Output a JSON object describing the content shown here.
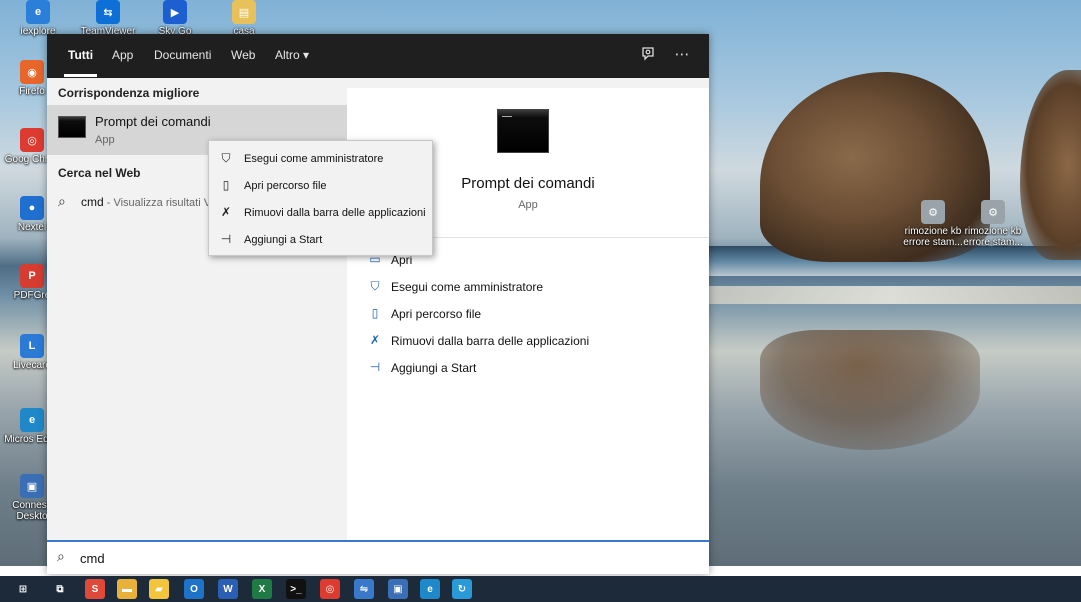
{
  "desktop": {
    "icons": [
      {
        "label": "iexplore",
        "color": "#2b7fd8",
        "glyph": "e",
        "icon": "internet-explorer-icon"
      },
      {
        "label": "TeamViewer",
        "color": "#0e6fd6",
        "glyph": "⇆",
        "icon": "teamviewer-icon"
      },
      {
        "label": "Sky Go",
        "color": "#1b5fd1",
        "glyph": "▶",
        "icon": "sky-go-icon"
      },
      {
        "label": "casa",
        "color": "#e9c15a",
        "glyph": "▤",
        "icon": "folder-icon"
      },
      {
        "label": "Firefo",
        "color": "#e7662b",
        "glyph": "◉",
        "icon": "firefox-icon"
      },
      {
        "label": "Goog Chron",
        "color": "#dd3b2f",
        "glyph": "◎",
        "icon": "chrome-icon"
      },
      {
        "label": "Nextel",
        "color": "#1f6fd0",
        "glyph": "●",
        "icon": "app-icon"
      },
      {
        "label": "PDFGre",
        "color": "#d63c2f",
        "glyph": "P",
        "icon": "pdf-icon"
      },
      {
        "label": "Livecare",
        "color": "#2a7ad6",
        "glyph": "L",
        "icon": "livecare-icon"
      },
      {
        "label": "Micros Edge",
        "color": "#1e88c9",
        "glyph": "e",
        "icon": "edge-icon"
      },
      {
        "label": "Conness Deskto",
        "color": "#3b6fb5",
        "glyph": "▣",
        "icon": "remote-desktop-icon"
      },
      {
        "label": "rimozione kb errore stam...",
        "color": "#9aa3aa",
        "glyph": "⚙",
        "icon": "script-icon"
      },
      {
        "label": "rimozione kb errore stam...",
        "color": "#9aa3aa",
        "glyph": "⚙",
        "icon": "script-icon"
      }
    ]
  },
  "start_menu": {
    "tabs": [
      "Tutti",
      "App",
      "Documenti",
      "Web",
      "Altro ▾"
    ],
    "best_match_header": "Corrispondenza migliore",
    "best_match": {
      "title": "Prompt dei comandi",
      "subtitle": "App"
    },
    "web_header": "Cerca nel Web",
    "web_result": {
      "query": "cmd",
      "desc": " - Visualizza risultati V"
    },
    "detail": {
      "title": "Prompt dei comandi",
      "subtitle": "App"
    },
    "actions": [
      {
        "label": "Apri",
        "icon": "▭"
      },
      {
        "label": "Esegui come amministratore",
        "icon": "⛉"
      },
      {
        "label": "Apri percorso file",
        "icon": "▯"
      },
      {
        "label": "Rimuovi dalla barra delle applicazioni",
        "icon": "✗"
      },
      {
        "label": "Aggiungi a Start",
        "icon": "⊣"
      }
    ],
    "search_value": "cmd"
  },
  "context_menu": {
    "items": [
      {
        "label": "Esegui come amministratore",
        "icon": "⛉"
      },
      {
        "label": "Apri percorso file",
        "icon": "▯"
      },
      {
        "label": "Rimuovi dalla barra delle applicazioni",
        "icon": "✗"
      },
      {
        "label": "Aggiungi a Start",
        "icon": "⊣"
      }
    ]
  },
  "taskbar": {
    "items": [
      {
        "icon": "windows-start-icon",
        "color": "#1c2a3a",
        "glyph": "⊞"
      },
      {
        "icon": "task-view-icon",
        "color": "#1c2a3a",
        "glyph": "⧉"
      },
      {
        "icon": "livecare-icon",
        "color": "#e0483a",
        "glyph": "S"
      },
      {
        "icon": "file-explorer-icon",
        "color": "#e8b23a",
        "glyph": "▬"
      },
      {
        "icon": "sticky-notes-icon",
        "color": "#f2c53d",
        "glyph": "▰"
      },
      {
        "icon": "outlook-icon",
        "color": "#1e73c8",
        "glyph": "O"
      },
      {
        "icon": "word-icon",
        "color": "#2b5fb4",
        "glyph": "W"
      },
      {
        "icon": "excel-icon",
        "color": "#1f7a45",
        "glyph": "X"
      },
      {
        "icon": "command-prompt-icon",
        "color": "#111111",
        "glyph": ">_"
      },
      {
        "icon": "chrome-icon",
        "color": "#dd3b2f",
        "glyph": "◎"
      },
      {
        "icon": "network-tool-icon",
        "color": "#3a78c9",
        "glyph": "⇋"
      },
      {
        "icon": "remote-desktop-icon",
        "color": "#3b6fb5",
        "glyph": "▣"
      },
      {
        "icon": "edge-icon",
        "color": "#1e88c9",
        "glyph": "e"
      },
      {
        "icon": "sync-icon",
        "color": "#2a9ad6",
        "glyph": "↻"
      }
    ]
  }
}
